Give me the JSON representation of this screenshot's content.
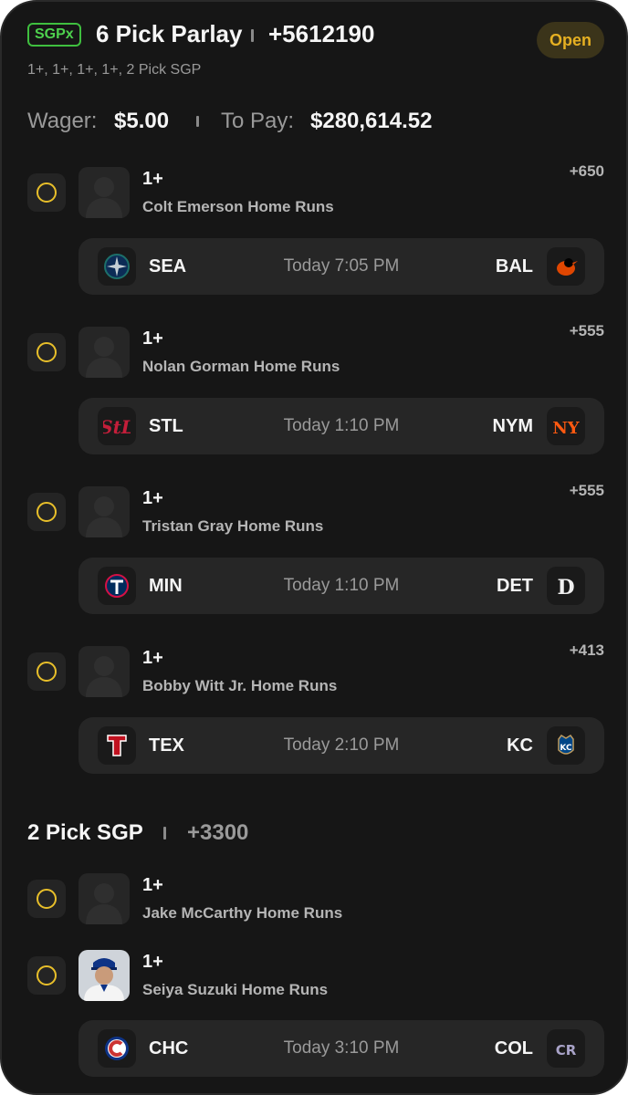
{
  "parlay": {
    "badge": "SGPx",
    "title": "6 Pick Parlay",
    "odds": "+5612190",
    "status": "Open",
    "subtitle": "1+, 1+, 1+, 1+, 2 Pick SGP",
    "wager_label": "Wager:",
    "wager_value": "$5.00",
    "topay_label": "To Pay:",
    "topay_value": "$280,614.52"
  },
  "picks": [
    {
      "line": "1+",
      "market": "Colt Emerson Home Runs",
      "odds": "+650",
      "game": {
        "away": "SEA",
        "home": "BAL",
        "time": "Today 7:05 PM",
        "away_icon": "mariners-logo-icon",
        "home_icon": "orioles-logo-icon"
      }
    },
    {
      "line": "1+",
      "market": "Nolan Gorman Home Runs",
      "odds": "+555",
      "game": {
        "away": "STL",
        "home": "NYM",
        "time": "Today 1:10 PM",
        "away_icon": "cardinals-logo-icon",
        "home_icon": "mets-logo-icon"
      }
    },
    {
      "line": "1+",
      "market": "Tristan Gray Home Runs",
      "odds": "+555",
      "game": {
        "away": "MIN",
        "home": "DET",
        "time": "Today 1:10 PM",
        "away_icon": "twins-logo-icon",
        "home_icon": "tigers-logo-icon"
      }
    },
    {
      "line": "1+",
      "market": "Bobby Witt Jr. Home Runs",
      "odds": "+413",
      "game": {
        "away": "TEX",
        "home": "KC",
        "time": "Today 2:10 PM",
        "away_icon": "rangers-logo-icon",
        "home_icon": "royals-logo-icon"
      }
    }
  ],
  "sgp": {
    "title": "2 Pick SGP",
    "odds": "+3300",
    "picks": [
      {
        "line": "1+",
        "market": "Jake McCarthy Home Runs"
      },
      {
        "line": "1+",
        "market": "Seiya Suzuki Home Runs"
      }
    ],
    "game": {
      "away": "CHC",
      "home": "COL",
      "time": "Today 3:10 PM",
      "away_icon": "cubs-logo-icon",
      "home_icon": "rockies-logo-icon"
    }
  },
  "colors": {
    "background": "#161616",
    "accent_yellow": "#e8bf2a",
    "badge_green": "#4ed24e",
    "open_text": "#e6b022"
  }
}
